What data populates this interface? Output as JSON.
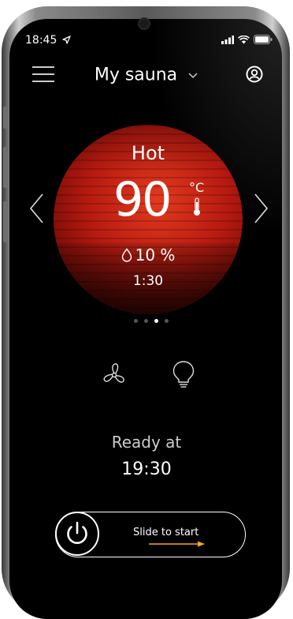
{
  "status": {
    "time": "18:45"
  },
  "header": {
    "title": "My sauna"
  },
  "sauna": {
    "mode": "Hot",
    "temperature": "90",
    "unit": "°C",
    "humidity": "10 %",
    "timer": "1:30"
  },
  "pager": {
    "count": 4,
    "active": 2
  },
  "schedule": {
    "label": "Ready at",
    "time": "19:30"
  },
  "start": {
    "label": "Slide to start"
  },
  "colors": {
    "accent": "#f5a623",
    "background": "#000000",
    "sauna_red": "#c2200f"
  }
}
